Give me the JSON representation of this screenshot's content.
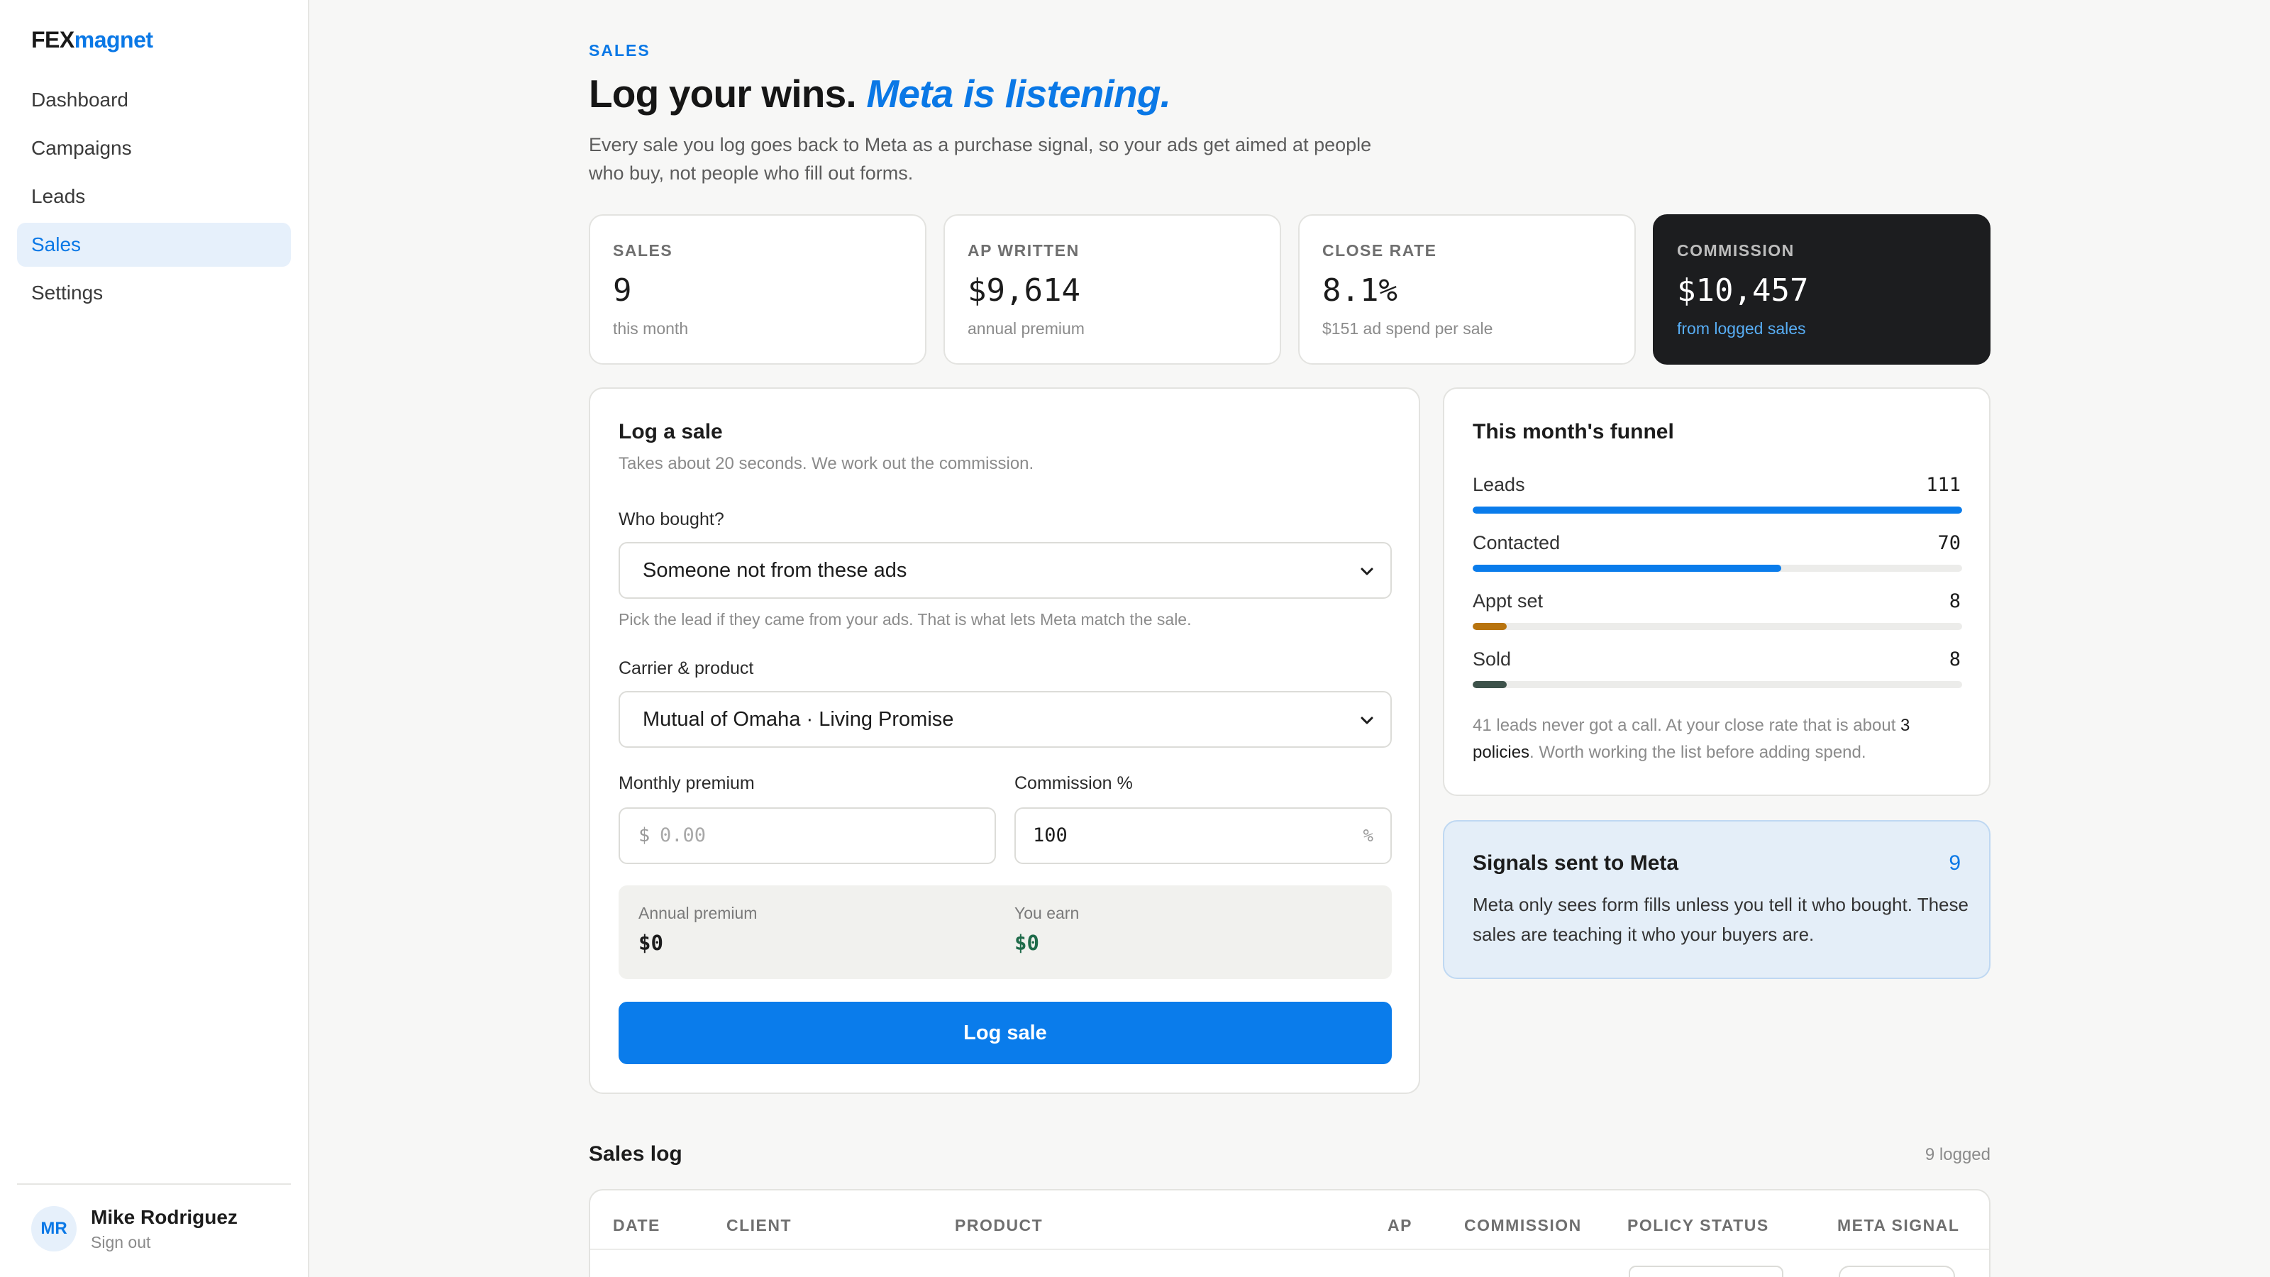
{
  "brand": {
    "part1": "FEX",
    "part2": "magnet"
  },
  "nav": [
    {
      "label": "Dashboard"
    },
    {
      "label": "Campaigns"
    },
    {
      "label": "Leads"
    },
    {
      "label": "Sales",
      "active": true
    },
    {
      "label": "Settings"
    }
  ],
  "user": {
    "initials": "MR",
    "name": "Mike Rodriguez",
    "signout": "Sign out"
  },
  "header": {
    "eyebrow": "SALES",
    "title": "Log your wins.",
    "title_accent": "Meta is listening.",
    "subtitle": "Every sale you log goes back to Meta as a purchase signal, so your ads get aimed at people who buy, not people who fill out forms."
  },
  "stats": [
    {
      "label": "SALES",
      "value": "9",
      "sub": "this month"
    },
    {
      "label": "AP WRITTEN",
      "value": "$9,614",
      "sub": "annual premium"
    },
    {
      "label": "CLOSE RATE",
      "value": "8.1%",
      "sub": "$151 ad spend per sale"
    },
    {
      "label": "COMMISSION",
      "value": "$10,457",
      "sub": "from logged sales"
    }
  ],
  "log_form": {
    "title": "Log a sale",
    "subtitle": "Takes about 20 seconds. We work out the commission.",
    "who_label": "Who bought?",
    "who_value": "Someone not from these ads",
    "who_help": "Pick the lead if they came from your ads. That is what lets Meta match the sale.",
    "carrier_label": "Carrier & product",
    "carrier_value": "Mutual of Omaha · Living Promise",
    "premium_label": "Monthly premium",
    "premium_prefix": "$",
    "premium_placeholder": "0.00",
    "commission_label": "Commission %",
    "commission_value": "100",
    "commission_suffix": "%",
    "annual_label": "Annual premium",
    "annual_value": "$0",
    "earn_label": "You earn",
    "earn_value": "$0",
    "submit_label": "Log sale"
  },
  "funnel": {
    "title": "This month's funnel",
    "rows": [
      {
        "label": "Leads",
        "value": "111",
        "fraction": 1.0,
        "color": "#0a7ceb"
      },
      {
        "label": "Contacted",
        "value": "70",
        "fraction": 0.63,
        "color": "#0a7ceb"
      },
      {
        "label": "Appt set",
        "value": "8",
        "fraction": 0.07,
        "color": "#b8740f"
      },
      {
        "label": "Sold",
        "value": "8",
        "fraction": 0.07,
        "color": "#3d524a"
      }
    ],
    "note_prefix": "41 leads never got a call. At your close rate that is about ",
    "note_bold": "3 policies",
    "note_suffix": ". Worth working the list before adding spend."
  },
  "signals": {
    "title": "Signals sent to Meta",
    "count": "9",
    "description": "Meta only sees form fills unless you tell it who bought. These sales are teaching it who your buyers are."
  },
  "sales_log": {
    "title": "Sales log",
    "count": "9 logged",
    "columns": [
      "DATE",
      "CLIENT",
      "PRODUCT",
      "AP",
      "COMMISSION",
      "POLICY STATUS",
      "META SIGNAL"
    ]
  },
  "colors": {
    "accent": "#0a78e6",
    "dark_card": "#1c1d1f",
    "signals_bg": "#e4eef8"
  }
}
